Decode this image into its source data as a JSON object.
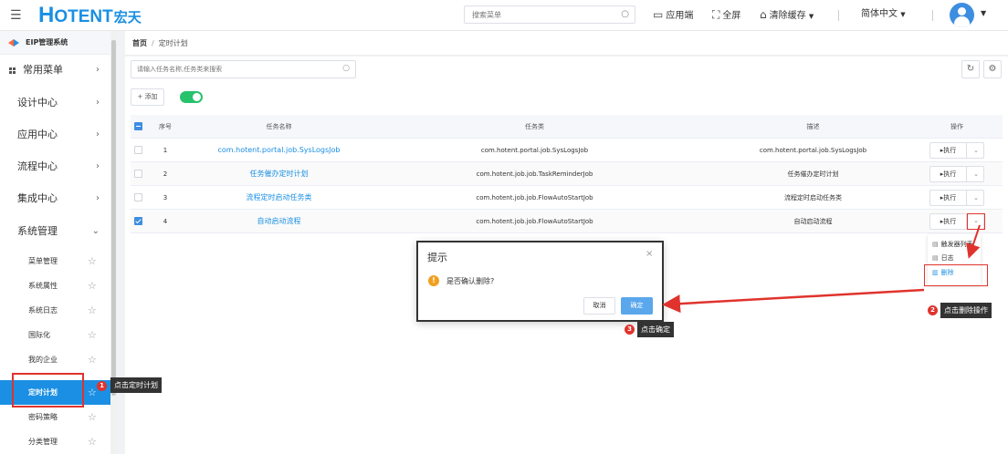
{
  "header": {
    "logo_main": "OTENT",
    "logo_h": "H",
    "logo_cn": "宏天",
    "search_placeholder": "搜索菜单",
    "app_label": "应用端",
    "fullscreen_label": "全屏",
    "clear_cache_label": "清除缓存",
    "language_label": "简体中文"
  },
  "sidebar": {
    "system_title": "EIP管理系统",
    "groups": [
      {
        "label": "常用菜单"
      },
      {
        "label": "设计中心"
      },
      {
        "label": "应用中心"
      },
      {
        "label": "流程中心"
      },
      {
        "label": "集成中心"
      },
      {
        "label": "系统管理"
      }
    ],
    "sub_items": [
      {
        "label": "菜单管理"
      },
      {
        "label": "系统属性"
      },
      {
        "label": "系统日志"
      },
      {
        "label": "国际化"
      },
      {
        "label": "我的企业"
      },
      {
        "label": "定时计划"
      },
      {
        "label": "密码策略"
      },
      {
        "label": "分类管理"
      }
    ]
  },
  "breadcrumb": {
    "home": "首页",
    "separator": "/",
    "current": "定时计划"
  },
  "toolbar": {
    "search_placeholder": "请输入任务名称,任务类来搜索",
    "add_label": "+ 添加"
  },
  "table": {
    "headers": {
      "index": "序号",
      "name": "任务名称",
      "class": "任务类",
      "desc": "描述",
      "op": "操作"
    },
    "rows": [
      {
        "index": "1",
        "name": "com.hotent.portal.job.SysLogsJob",
        "class": "com.hotent.portal.job.SysLogsJob",
        "desc": "com.hotent.portal.job.SysLogsJob",
        "exec": "▸执行",
        "checked": false
      },
      {
        "index": "2",
        "name": "任务催办定时计划",
        "class": "com.hotent.job.job.TaskReminderJob",
        "desc": "任务催办定时计划",
        "exec": "▸执行",
        "checked": false
      },
      {
        "index": "3",
        "name": "流程定时启动任务类",
        "class": "com.hotent.job.job.FlowAutoStartJob",
        "desc": "流程定时启动任务类",
        "exec": "▸执行",
        "checked": false
      },
      {
        "index": "4",
        "name": "自动启动流程",
        "class": "com.hotent.job.job.FlowAutoStartJob",
        "desc": "自动启动流程",
        "exec": "▸执行",
        "checked": true
      }
    ]
  },
  "dropdown_menu": {
    "items": [
      {
        "label": "触发器列表"
      },
      {
        "label": "日志"
      },
      {
        "label": "删除"
      }
    ]
  },
  "dialog": {
    "title": "提示",
    "close": "×",
    "message": "是否确认删除?",
    "cancel": "取消",
    "ok": "确定"
  },
  "annotations": [
    {
      "number": "1",
      "text": "点击定时计划"
    },
    {
      "number": "2",
      "text": "点击删除操作"
    },
    {
      "number": "3",
      "text": "点击确定"
    }
  ],
  "colors": {
    "primary": "#1a8fe3",
    "annotation": "#e0332d",
    "toggle_on": "#27c26c",
    "warning": "#f0a020"
  }
}
